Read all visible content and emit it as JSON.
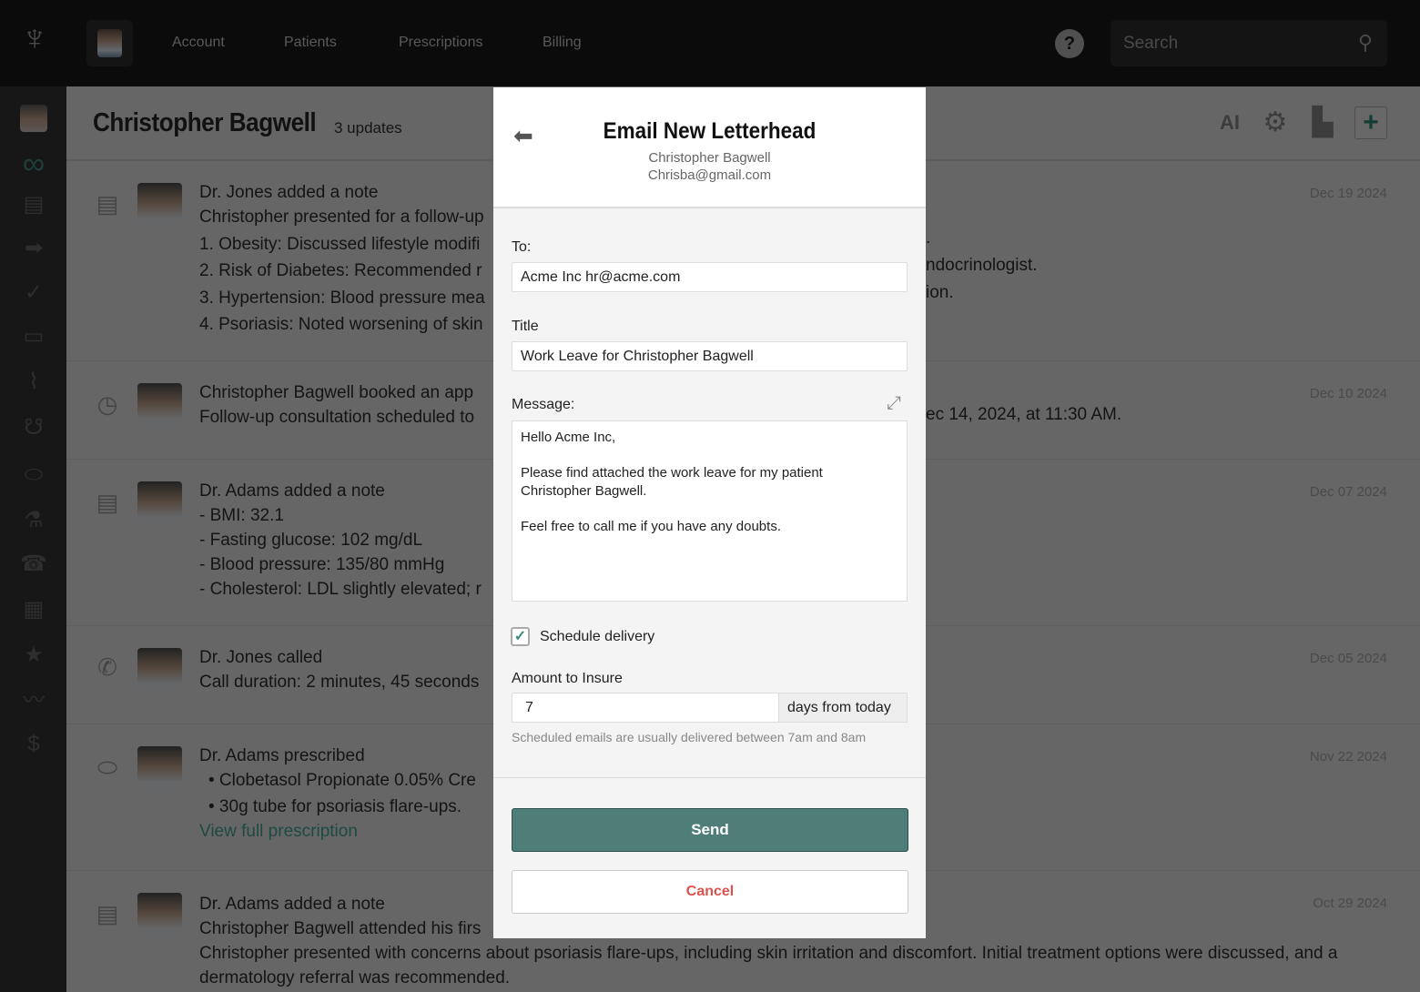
{
  "nav": {
    "items": [
      "Account",
      "Patients",
      "Prescriptions",
      "Billing"
    ],
    "search_placeholder": "Search",
    "help": "?"
  },
  "page": {
    "title": "Christopher Bagwell",
    "updates": "3 updates"
  },
  "feed": [
    {
      "icon": "note-icon",
      "title": "Dr. Jones added a note",
      "lines": [
        "Christopher presented for a follow-up",
        "1. Obesity: Discussed lifestyle modifi",
        "2. Risk of Diabetes: Recommended r",
        "3. Hypertension: Blood pressure mea",
        "4. Psoriasis: Noted worsening of skin"
      ],
      "fragments": [
        ".",
        "ndocrinologist.",
        "ion."
      ],
      "date": "Dec 19 2024"
    },
    {
      "icon": "clock-icon",
      "title": "Christopher Bagwell booked an app",
      "lines": [
        "Follow-up consultation scheduled to"
      ],
      "fragments": [
        "ec 14, 2024, at 11:30 AM."
      ],
      "date": "Dec 10 2024"
    },
    {
      "icon": "note-icon",
      "title": "Dr. Adams added a note",
      "lines": [
        "- BMI: 32.1",
        "- Fasting glucose: 102 mg/dL",
        "- Blood pressure: 135/80 mmHg",
        "- Cholesterol: LDL slightly elevated; r"
      ],
      "date": "Dec 07 2024"
    },
    {
      "icon": "phone-icon",
      "title": "Dr. Jones called",
      "lines": [
        "Call duration: 2 minutes, 45 seconds"
      ],
      "date": "Dec 05 2024"
    },
    {
      "icon": "pill-icon",
      "title": "Dr. Adams prescribed",
      "lines": [
        "•  Clobetasol Propionate 0.05% Cre",
        "•  30g tube for psoriasis flare-ups."
      ],
      "link": "View full prescription",
      "date": "Nov 22 2024"
    },
    {
      "icon": "note-icon",
      "title": "Dr. Adams added a note",
      "lines": [
        "Christopher Bagwell attended his firs",
        "Christopher presented with concerns about psoriasis flare-ups, including skin irritation and discomfort. Initial treatment options were discussed, and a",
        "dermatology referral was recommended."
      ],
      "date": "Oct 29 2024"
    }
  ],
  "modal": {
    "title": "Email New Letterhead",
    "name": "Christopher Bagwell",
    "email": "Chrisba@gmail.com",
    "to_label": "To:",
    "to_value": "Acme Inc hr@acme.com",
    "title_label": "Title",
    "title_value": "Work Leave for Christopher Bagwell",
    "message_label": "Message:",
    "message_value": "Hello Acme Inc,\n\nPlease find attached the work leave for my patient\nChristopher Bagwell.\n\nFeel free to call me if you have any doubts.",
    "schedule_label": "Schedule delivery",
    "schedule_checked": true,
    "check": "✓",
    "amount_label": "Amount to Insure",
    "amount_value": "7",
    "amount_addon": "days from today",
    "hint": "Scheduled emails are usually delivered between 7am and 8am",
    "send": "Send",
    "cancel": "Cancel"
  },
  "colors": {
    "accent": "#4f7e79",
    "cancel": "#d9534f",
    "link": "#3e8b7e"
  }
}
